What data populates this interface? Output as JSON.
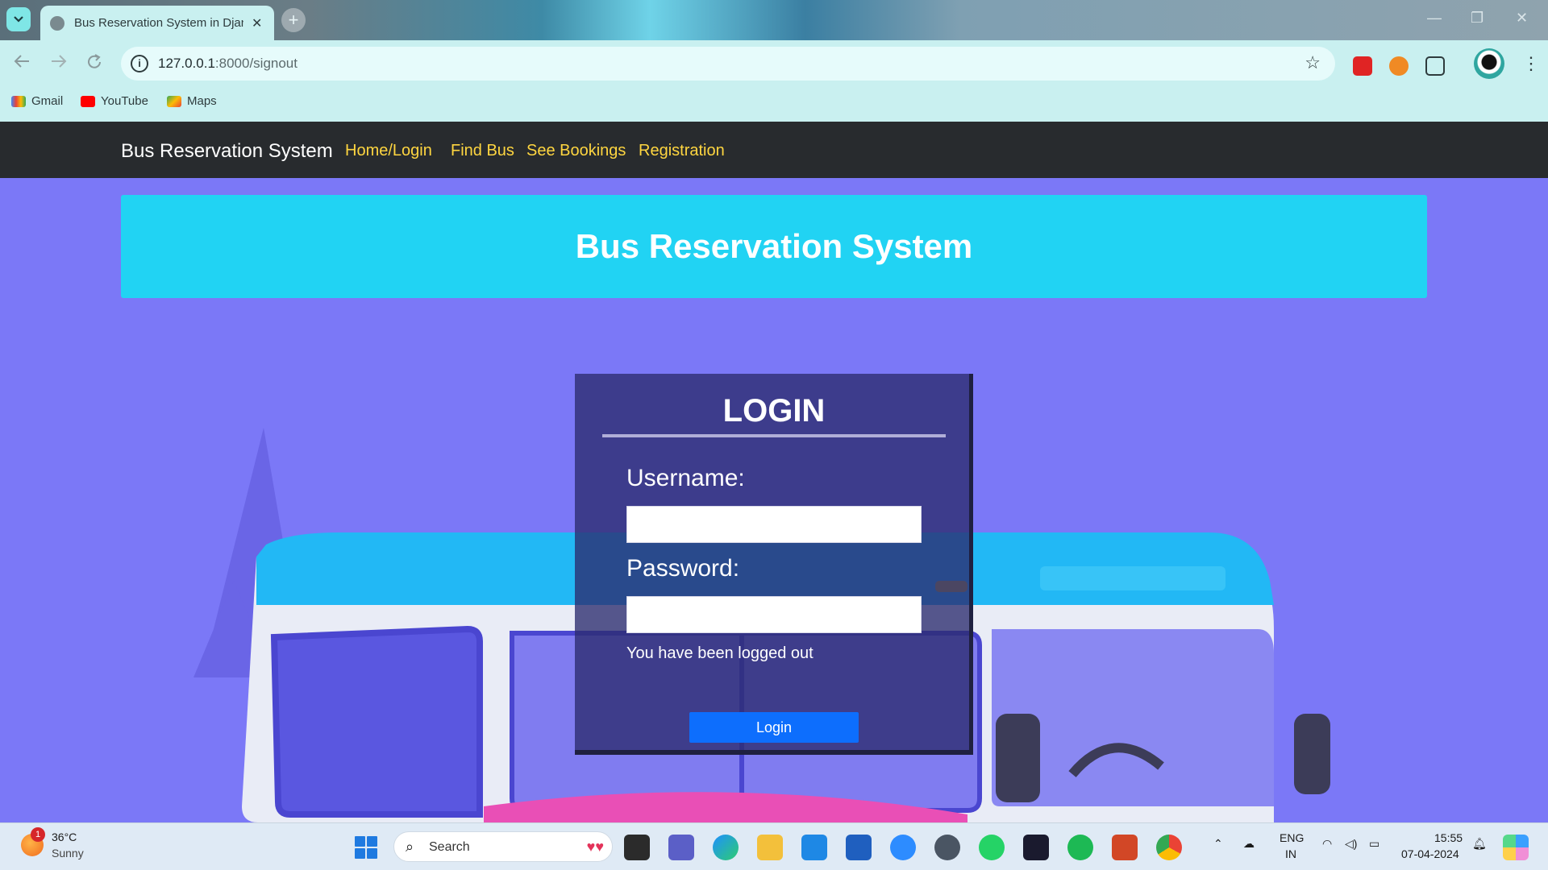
{
  "browser": {
    "tab_title": "Bus Reservation System in Djan",
    "tab_close": "✕",
    "new_tab": "+",
    "url_host": "127.0.0.1",
    "url_path": ":8000/signout",
    "window_controls": [
      "—",
      "❐",
      "✕"
    ],
    "bookmarks": [
      "Gmail",
      "YouTube",
      "Maps"
    ]
  },
  "site_nav": {
    "brand": "Bus Reservation System",
    "links": [
      "Home/Login",
      "Find Bus",
      "See Bookings",
      "Registration"
    ]
  },
  "banner": {
    "title": "Bus Reservation System"
  },
  "login": {
    "title": "LOGIN",
    "username_label": "Username:",
    "username_value": "",
    "password_label": "Password:",
    "password_value": "",
    "message": "You have been logged out",
    "button_label": "Login"
  },
  "taskbar": {
    "weather_badge": "1",
    "temperature": "36°C",
    "condition": "Sunny",
    "search_placeholder": "Search",
    "language_1": "ENG",
    "language_2": "IN",
    "time": "15:55",
    "date": "07-04-2024"
  },
  "colors": {
    "page_bg": "#7b78f7",
    "banner_bg": "#21d3f3",
    "nav_bg": "#282b2e",
    "nav_link": "#ffd640",
    "login_button": "#0d6efd"
  }
}
